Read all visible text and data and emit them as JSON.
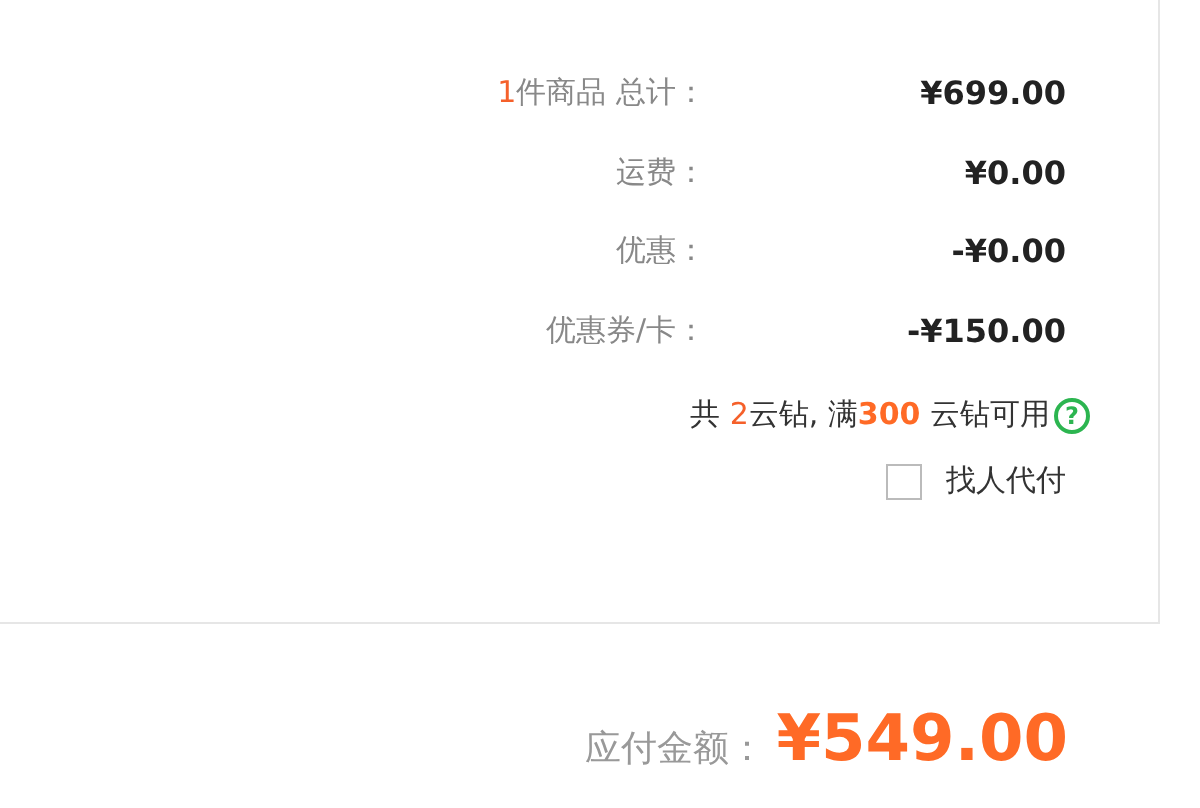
{
  "summary": {
    "item_count": "1",
    "rows": [
      {
        "label": "件商品 总计：",
        "value": "¥699.00"
      },
      {
        "label": "运费：",
        "value": "¥0.00"
      },
      {
        "label": "优惠：",
        "value": "-¥0.00"
      },
      {
        "label": "优惠券/卡：",
        "value": "-¥150.00"
      }
    ]
  },
  "coins": {
    "prefix": "共 ",
    "count": "2",
    "middle": "云钻, 满",
    "threshold": "300",
    "suffix": " 云钻可用",
    "help_icon": "?"
  },
  "pay_for_me": {
    "label": "找人代付",
    "checked": false
  },
  "total": {
    "label": "应付金额：",
    "value": "¥549.00"
  }
}
